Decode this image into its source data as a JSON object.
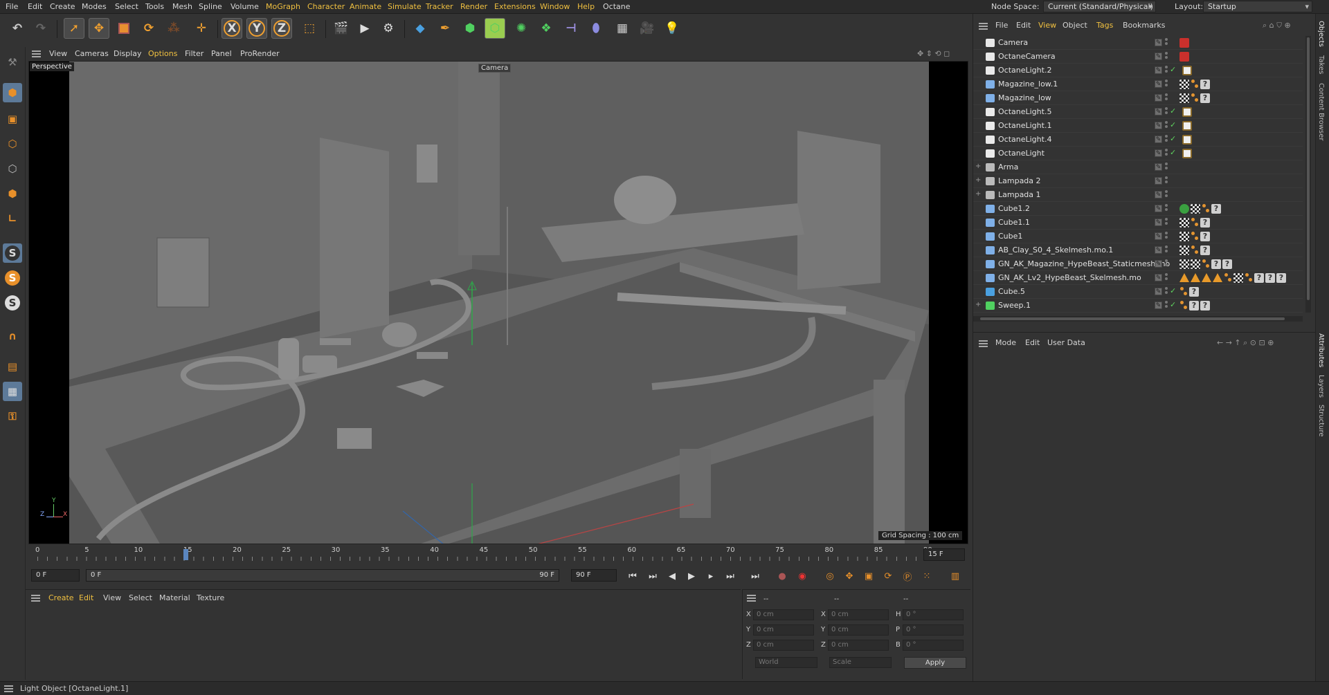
{
  "menubar": {
    "items": [
      "File",
      "Edit",
      "Create",
      "Modes",
      "Select",
      "Tools",
      "Mesh",
      "Spline",
      "Volume",
      "MoGraph",
      "Character",
      "Animate",
      "Simulate",
      "Tracker",
      "Render",
      "Extensions",
      "Window",
      "Help",
      "Octane"
    ],
    "node_space_label": "Node Space:",
    "node_space_value": "Current (Standard/Physical)",
    "layout_label": "Layout:",
    "layout_value": "Startup"
  },
  "toolbar": {
    "icons": [
      "undo-icon",
      "redo-icon",
      "select-arrow-icon",
      "move-icon",
      "scale-icon",
      "rotate-icon",
      "recent-tools-icon",
      "live-selection-icon",
      "x-axis-icon",
      "y-axis-icon",
      "z-axis-icon",
      "coordinate-system-icon",
      "render-view-icon",
      "render-picture-viewer-icon",
      "render-settings-icon",
      "cube-primitive-icon",
      "pen-spline-icon",
      "subdivision-icon",
      "extrude-icon",
      "mograph-cloner-icon",
      "array-icon",
      "deformer-icon",
      "field-icon",
      "floor-icon",
      "camera-icon",
      "light-icon"
    ],
    "axis_x": "X",
    "axis_y": "Y",
    "axis_z": "Z"
  },
  "left_tools": {
    "icons": [
      "make-editable-icon",
      "model-mode-icon",
      "texture-mode-icon",
      "point-mode-icon",
      "edge-mode-icon",
      "polygon-mode-icon",
      "axis-mode-icon",
      "snap-icon",
      "snap-settings-icon",
      "workplane-icon",
      "magnet-icon",
      "grid-icon",
      "layer-icon",
      "lock-icon"
    ],
    "s_label": "S"
  },
  "viewport": {
    "menu": [
      "View",
      "Cameras",
      "Display",
      "Options",
      "Filter",
      "Panel",
      "ProRender"
    ],
    "perspective_label": "Perspective",
    "camera_label": "Camera",
    "grid_spacing": "Grid Spacing : 100 cm",
    "axis_x": "X",
    "axis_y": "Y",
    "axis_z": "Z"
  },
  "timeline": {
    "ticks": [
      "0",
      "5",
      "10",
      "15",
      "20",
      "25",
      "30",
      "35",
      "40",
      "45",
      "50",
      "55",
      "60",
      "65",
      "70",
      "75",
      "80",
      "85",
      "90"
    ],
    "current_frame": "15 F",
    "current_frame_value": 15,
    "max_frame": 90
  },
  "transport": {
    "start_field": "0 F",
    "range_start": "0 F",
    "range_end": "90 F",
    "end_field": "90 F"
  },
  "material_panel": {
    "menu": [
      "Create",
      "Edit",
      "View",
      "Select",
      "Material",
      "Texture"
    ]
  },
  "coord_panel": {
    "headers": [
      "--",
      "--",
      "--"
    ],
    "rows": [
      {
        "a": "X",
        "av": "0 cm",
        "b": "X",
        "bv": "0 cm",
        "c": "H",
        "cv": "0 °"
      },
      {
        "a": "Y",
        "av": "0 cm",
        "b": "Y",
        "bv": "0 cm",
        "c": "P",
        "cv": "0 °"
      },
      {
        "a": "Z",
        "av": "0 cm",
        "b": "Z",
        "bv": "0 cm",
        "c": "B",
        "cv": "0 °"
      }
    ],
    "world_select": "World",
    "scale_select": "Scale",
    "apply_label": "Apply"
  },
  "objects_panel": {
    "menu": [
      "File",
      "Edit",
      "View",
      "Object",
      "Tags",
      "Bookmarks"
    ],
    "rows": [
      {
        "name": "Camera",
        "icon": "camera-icon",
        "expand": "",
        "tags": [
          "cam"
        ],
        "check": false
      },
      {
        "name": "OctaneCamera",
        "icon": "camera-icon",
        "expand": "",
        "tags": [
          "cam"
        ],
        "check": false
      },
      {
        "name": "OctaneLight.2",
        "icon": "light-icon",
        "expand": "",
        "tags": [
          "lt"
        ],
        "check": true
      },
      {
        "name": "Magazine_low.1",
        "icon": "polygon-object-icon",
        "expand": "",
        "tags": [
          "ch",
          "or",
          "q"
        ],
        "check": false
      },
      {
        "name": "Magazine_low",
        "icon": "polygon-object-icon",
        "expand": "",
        "tags": [
          "ch",
          "or",
          "q"
        ],
        "check": false
      },
      {
        "name": "OctaneLight.5",
        "icon": "light-icon",
        "expand": "",
        "tags": [
          "lt"
        ],
        "check": true
      },
      {
        "name": "OctaneLight.1",
        "icon": "light-icon",
        "expand": "",
        "tags": [
          "lt"
        ],
        "check": true
      },
      {
        "name": "OctaneLight.4",
        "icon": "light-icon",
        "expand": "",
        "tags": [
          "lt"
        ],
        "check": true
      },
      {
        "name": "OctaneLight",
        "icon": "light-icon",
        "expand": "",
        "tags": [
          "lt"
        ],
        "check": true
      },
      {
        "name": "Arma",
        "icon": "null-object-icon",
        "expand": "+",
        "tags": [],
        "check": false
      },
      {
        "name": "Lampada 2",
        "icon": "null-object-icon",
        "expand": "+",
        "tags": [],
        "check": false
      },
      {
        "name": "Lampada 1",
        "icon": "null-object-icon",
        "expand": "+",
        "tags": [],
        "check": false
      },
      {
        "name": "Cube1.2",
        "icon": "polygon-object-icon",
        "expand": "",
        "tags": [
          "grn",
          "ch",
          "or",
          "q"
        ],
        "check": false
      },
      {
        "name": "Cube1.1",
        "icon": "polygon-object-icon",
        "expand": "",
        "tags": [
          "ch",
          "or",
          "q"
        ],
        "check": false
      },
      {
        "name": "Cube1",
        "icon": "polygon-object-icon",
        "expand": "",
        "tags": [
          "ch",
          "or",
          "q"
        ],
        "check": false
      },
      {
        "name": "AB_Clay_S0_4_Skelmesh.mo.1",
        "icon": "polygon-object-icon",
        "expand": "",
        "tags": [
          "ch",
          "or",
          "q"
        ],
        "check": false
      },
      {
        "name": "GN_AK_Magazine_HypeBeast_Staticmesh.mo",
        "icon": "polygon-object-icon",
        "expand": "",
        "tags": [
          "ch",
          "ch",
          "or",
          "q",
          "q"
        ],
        "check": false
      },
      {
        "name": "GN_AK_Lv2_HypeBeast_Skelmesh.mo",
        "icon": "polygon-object-icon",
        "expand": "",
        "tags": [
          "tri",
          "tri",
          "tri",
          "tri",
          "or",
          "ch",
          "or",
          "q",
          "q",
          "q"
        ],
        "check": false
      },
      {
        "name": "Cube.5",
        "icon": "cube-icon",
        "expand": "",
        "tags": [
          "or",
          "q"
        ],
        "check": true
      },
      {
        "name": "Sweep.1",
        "icon": "sweep-icon",
        "expand": "+",
        "tags": [
          "or",
          "q",
          "q"
        ],
        "check": true
      }
    ]
  },
  "attributes_panel": {
    "menu": [
      "Mode",
      "Edit",
      "User Data"
    ]
  },
  "side_tabs": [
    "Objects",
    "Takes",
    "Content Browser",
    "Attributes",
    "Layers",
    "Structure"
  ],
  "status": {
    "text": "Light Object [OctaneLight.1]"
  },
  "colors": {
    "accent_yellow": "#f0c040",
    "selection_blue": "#5d7a99",
    "check_green": "#5ed35e",
    "record_red": "#d43a2a",
    "orange_tool": "#e8902a"
  }
}
